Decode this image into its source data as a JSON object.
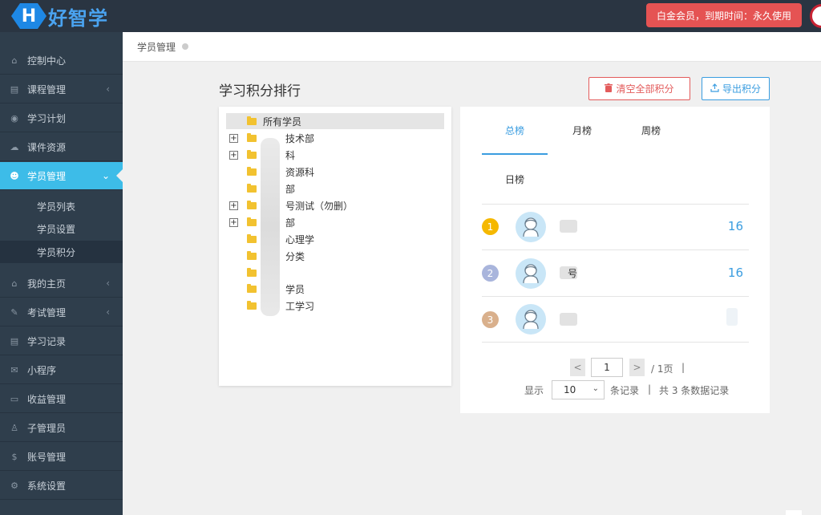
{
  "brand": {
    "badge": "H",
    "name": "好智学"
  },
  "membership": "白金会员，到期时间：永久使用",
  "sidebar": {
    "items": [
      {
        "label": "控制中心",
        "icon": "⌂"
      },
      {
        "label": "课程管理",
        "icon": "▤",
        "caret": "‹"
      },
      {
        "label": "学习计划",
        "icon": "◉"
      },
      {
        "label": "课件资源",
        "icon": "☁"
      },
      {
        "label": "学员管理",
        "icon": "☻",
        "caret": "⌄"
      },
      {
        "label": "我的主页",
        "icon": "⌂",
        "caret": "‹"
      },
      {
        "label": "考试管理",
        "icon": "✎",
        "caret": "‹"
      },
      {
        "label": "学习记录",
        "icon": "▤"
      },
      {
        "label": "小程序",
        "icon": "✉"
      },
      {
        "label": "收益管理",
        "icon": "▭"
      },
      {
        "label": "子管理员",
        "icon": "♙"
      },
      {
        "label": "账号管理",
        "icon": "$"
      },
      {
        "label": "系统设置",
        "icon": "⚙"
      }
    ],
    "subitems": [
      {
        "label": "学员列表"
      },
      {
        "label": "学员设置"
      },
      {
        "label": "学员积分"
      }
    ]
  },
  "breadcrumb": "学员管理",
  "page": {
    "title": "学习积分排行",
    "clear_label": "清空全部积分",
    "export_label": "导出积分"
  },
  "tree": {
    "nodes": [
      {
        "label": "所有学员"
      },
      {
        "label": "技术部"
      },
      {
        "label": "科"
      },
      {
        "label": "资源科"
      },
      {
        "label": "部"
      },
      {
        "label": "号测试（勿删）"
      },
      {
        "label": "部"
      },
      {
        "label": "心理学"
      },
      {
        "label": "分类"
      },
      {
        "label": ""
      },
      {
        "label": "学员"
      },
      {
        "label": "工学习"
      }
    ]
  },
  "ranking": {
    "tabs": [
      {
        "label": "总榜"
      },
      {
        "label": "月榜"
      },
      {
        "label": "周榜"
      },
      {
        "label": "日榜"
      }
    ],
    "colors": {
      "gold": "#f5b800",
      "silver": "#a9b5dc",
      "bronze": "#d9b08c",
      "accent": "#3a9de0"
    },
    "rows": [
      {
        "rank": "1",
        "name": "",
        "score": "16"
      },
      {
        "rank": "2",
        "name": "号",
        "score": "16"
      },
      {
        "rank": "3",
        "name": "",
        "score": ""
      }
    ]
  },
  "pagination": {
    "prev": "<",
    "next": ">",
    "current_page": "1",
    "total_pages": "/ 1页",
    "sep": "|",
    "show_label": "显示",
    "page_size": "10",
    "records_label": "条记录",
    "summary": "共 3 条数据记录"
  }
}
